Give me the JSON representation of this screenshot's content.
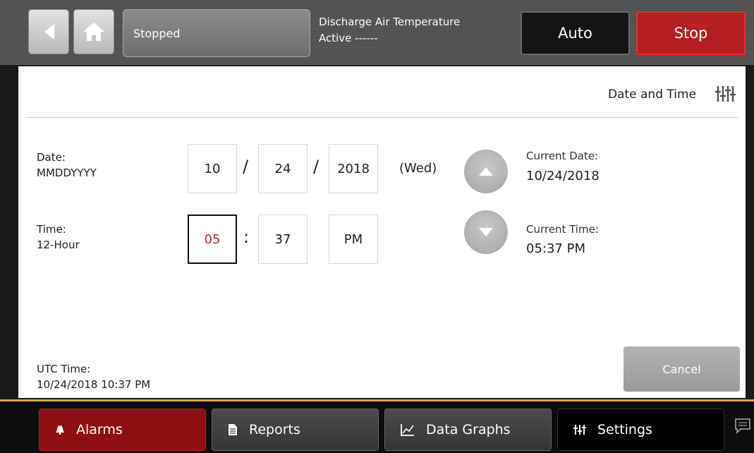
{
  "header": {
    "status_text": "Stopped",
    "info_title": "Discharge Air Temperature",
    "info_sub": "Active ------",
    "auto_label": "Auto",
    "stop_label": "Stop"
  },
  "panel": {
    "title": "Date and Time",
    "date_label": "Date:",
    "date_format": "MMDDYYYY",
    "time_label": "Time:",
    "time_format": "12-Hour",
    "date_month": "10",
    "date_day": "24",
    "date_year": "2018",
    "date_sep": "/",
    "weekday": "(Wed)",
    "time_hour": "05",
    "time_sep": ":",
    "time_minute": "37",
    "time_ampm": "PM",
    "current_date_label": "Current Date:",
    "current_date_value": "10/24/2018",
    "current_time_label": "Current Time:",
    "current_time_value": "05:37 PM",
    "utc_label": "UTC Time:",
    "utc_value": "10/24/2018 10:37 PM",
    "cancel_label": "Cancel"
  },
  "bottom_nav": {
    "alarms": "Alarms",
    "reports": "Reports",
    "graphs": "Data Graphs",
    "settings": "Settings"
  },
  "icons": {
    "back": "back-arrow-icon",
    "home": "home-icon",
    "settings": "sliders-icon",
    "up": "arrow-up-icon",
    "down": "arrow-down-icon",
    "alarm": "bell-icon",
    "report": "document-icon",
    "graph": "chart-icon",
    "message": "message-icon"
  },
  "colors": {
    "stop": "#b51f24",
    "alarm_tab": "#8e0f12",
    "active_hour": "#c0282b",
    "accent_line": "#d8a83a"
  }
}
